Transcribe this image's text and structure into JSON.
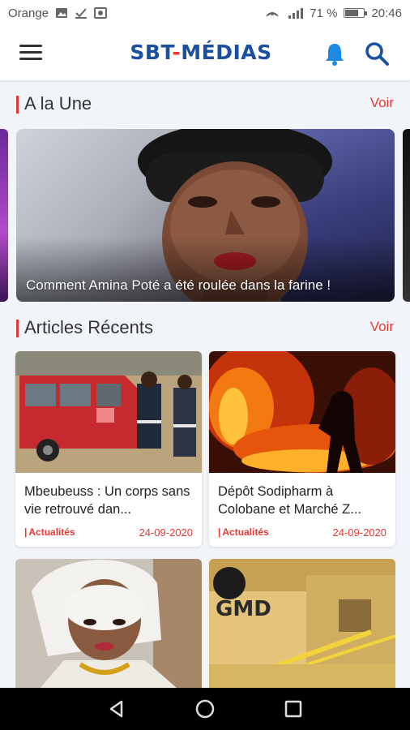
{
  "status_bar": {
    "carrier": "Orange",
    "signal_text": "⁴⁶",
    "battery_percent": "71 %",
    "battery_level": 0.71,
    "time": "20:46"
  },
  "header": {
    "brand_prefix": "SBT",
    "brand_sep": "-",
    "brand_suffix": "MÉDIAS",
    "brand_color": "#1a4fa3",
    "menu_icon": "hamburger-icon",
    "bell_icon": "bell-icon",
    "search_icon": "search-icon"
  },
  "a_la_une": {
    "title": "A la Une",
    "voir": "Voir",
    "featured_caption": "Comment Amina Poté a été roulée dans la farine !"
  },
  "recent": {
    "title": "Articles Récents",
    "voir": "Voir",
    "articles": [
      {
        "headline": "Mbeubeuss : Un corps sans vie retrouvé dan...",
        "category": "Actualités",
        "date": "24-09-2020"
      },
      {
        "headline": "Dépôt Sodipharm à Colobane et Marché Z...",
        "category": "Actualités",
        "date": "24-09-2020"
      }
    ],
    "bottom_cards": [
      {
        "label": "GMD"
      },
      {
        "label": ""
      }
    ]
  },
  "accent_color": "#e53935",
  "nav": {
    "back_icon": "back-triangle-icon",
    "home_icon": "home-circle-icon",
    "recents_icon": "recents-square-icon"
  }
}
